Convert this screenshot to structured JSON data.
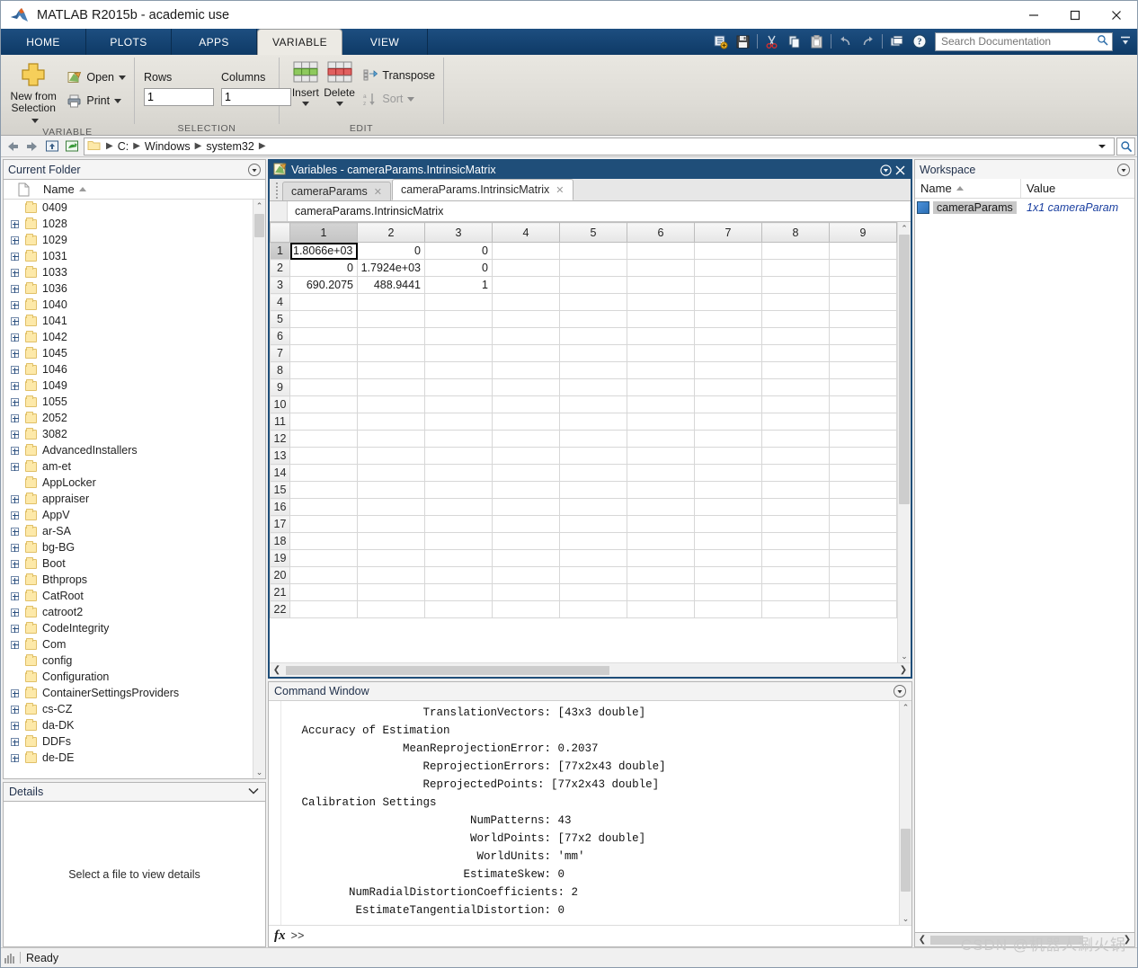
{
  "window": {
    "title": "MATLAB R2015b - academic use",
    "app_icon": "matlab-logo-icon",
    "minimize": "minimize-icon",
    "maximize": "maximize-icon",
    "close": "close-icon"
  },
  "ribbon": {
    "tabs": [
      {
        "label": "HOME",
        "active": false
      },
      {
        "label": "PLOTS",
        "active": false
      },
      {
        "label": "APPS",
        "active": false
      },
      {
        "label": "VARIABLE",
        "active": true
      },
      {
        "label": "VIEW",
        "active": false
      }
    ],
    "quick_access": [
      "new-script-icon",
      "save-icon",
      "cut-icon",
      "copy-icon",
      "paste-icon",
      "undo-icon",
      "redo-icon",
      "switch-windows-icon",
      "help-icon"
    ],
    "search": {
      "placeholder": "Search Documentation",
      "value": "",
      "icon": "search-icon"
    },
    "minimize_ribbon": "minimize-ribbon-icon",
    "groups": [
      {
        "name": "VARIABLE",
        "label": "VARIABLE",
        "new_from_selection": "New from\nSelection",
        "new_from_selection_line1": "New from",
        "new_from_selection_line2": "Selection",
        "open_label": "Open",
        "print_label": "Print"
      },
      {
        "name": "SELECTION",
        "label": "SELECTION",
        "rows_label": "Rows",
        "rows_value": "1",
        "columns_label": "Columns",
        "columns_value": "1"
      },
      {
        "name": "EDIT",
        "label": "EDIT",
        "insert_label": "Insert",
        "delete_label": "Delete",
        "transpose_label": "Transpose",
        "sort_label": "Sort"
      }
    ]
  },
  "addressbar": {
    "back_icon": "back-arrow-icon",
    "forward_icon": "forward-arrow-icon",
    "up_icon": "up-folder-icon",
    "browse_icon": "browse-folder-icon",
    "folder_icon": "folder-icon",
    "crumbs": [
      "C:",
      "Windows",
      "system32"
    ],
    "dropdown_icon": "chevron-down-icon",
    "search_icon": "search-icon"
  },
  "current_folder": {
    "title": "Current Folder",
    "panel_menu_icon": "panel-menu-icon",
    "columns": [
      "Name"
    ],
    "sort_icon": "sort-ascending-icon",
    "file_icon": "file-icon",
    "items": [
      {
        "name": "0409",
        "expandable": false
      },
      {
        "name": "1028",
        "expandable": true
      },
      {
        "name": "1029",
        "expandable": true
      },
      {
        "name": "1031",
        "expandable": true
      },
      {
        "name": "1033",
        "expandable": true
      },
      {
        "name": "1036",
        "expandable": true
      },
      {
        "name": "1040",
        "expandable": true
      },
      {
        "name": "1041",
        "expandable": true
      },
      {
        "name": "1042",
        "expandable": true
      },
      {
        "name": "1045",
        "expandable": true
      },
      {
        "name": "1046",
        "expandable": true
      },
      {
        "name": "1049",
        "expandable": true
      },
      {
        "name": "1055",
        "expandable": true
      },
      {
        "name": "2052",
        "expandable": true
      },
      {
        "name": "3082",
        "expandable": true
      },
      {
        "name": "AdvancedInstallers",
        "expandable": true
      },
      {
        "name": "am-et",
        "expandable": true
      },
      {
        "name": "AppLocker",
        "expandable": false
      },
      {
        "name": "appraiser",
        "expandable": true
      },
      {
        "name": "AppV",
        "expandable": true
      },
      {
        "name": "ar-SA",
        "expandable": true
      },
      {
        "name": "bg-BG",
        "expandable": true
      },
      {
        "name": "Boot",
        "expandable": true
      },
      {
        "name": "Bthprops",
        "expandable": true
      },
      {
        "name": "CatRoot",
        "expandable": true
      },
      {
        "name": "catroot2",
        "expandable": true
      },
      {
        "name": "CodeIntegrity",
        "expandable": true
      },
      {
        "name": "Com",
        "expandable": true
      },
      {
        "name": "config",
        "expandable": false
      },
      {
        "name": "Configuration",
        "expandable": false
      },
      {
        "name": "ContainerSettingsProviders",
        "expandable": true
      },
      {
        "name": "cs-CZ",
        "expandable": true
      },
      {
        "name": "da-DK",
        "expandable": true
      },
      {
        "name": "DDFs",
        "expandable": true
      },
      {
        "name": "de-DE",
        "expandable": true
      }
    ]
  },
  "details": {
    "title": "Details",
    "collapse_icon": "chevron-down-icon",
    "empty_message": "Select a file to view details"
  },
  "variables": {
    "window_title": "Variables - cameraParams.IntrinsicMatrix",
    "window_icon": "variable-editor-icon",
    "menu_icon": "panel-menu-icon",
    "close_icon": "close-icon",
    "tabs": [
      {
        "label": "cameraParams",
        "active": false,
        "close_icon": "close-tab-icon"
      },
      {
        "label": "cameraParams.IntrinsicMatrix",
        "active": true,
        "close_icon": "close-tab-icon"
      }
    ],
    "variable_name": "cameraParams.IntrinsicMatrix",
    "column_headers": [
      "1",
      "2",
      "3",
      "4",
      "5",
      "6",
      "7",
      "8",
      "9"
    ],
    "row_headers": [
      "1",
      "2",
      "3",
      "4",
      "5",
      "6",
      "7",
      "8",
      "9",
      "10",
      "11",
      "12",
      "13",
      "14",
      "15",
      "16",
      "17",
      "18",
      "19",
      "20",
      "21",
      "22"
    ],
    "selected_cell": {
      "row": 1,
      "col": 1
    },
    "data": [
      [
        "1.8066e+03",
        "0",
        "0",
        "",
        "",
        "",
        "",
        "",
        ""
      ],
      [
        "0",
        "1.7924e+03",
        "0",
        "",
        "",
        "",
        "",
        "",
        ""
      ],
      [
        "690.2075",
        "488.9441",
        "1",
        "",
        "",
        "",
        "",
        "",
        ""
      ]
    ],
    "hscroll_left_icon": "scroll-left-icon",
    "hscroll_right_icon": "scroll-right-icon"
  },
  "command_window": {
    "title": "Command Window",
    "menu_icon": "panel-menu-icon",
    "prompt_icon": "fx-icon",
    "prompt": ">>",
    "lines": [
      "                     TranslationVectors: [43x3 double]",
      "   Accuracy of Estimation",
      "                  MeanReprojectionError: 0.2037",
      "                     ReprojectionErrors: [77x2x43 double]",
      "                     ReprojectedPoints: [77x2x43 double]",
      "   Calibration Settings",
      "                            NumPatterns: 43",
      "                            WorldPoints: [77x2 double]",
      "                             WorldUnits: 'mm'",
      "                           EstimateSkew: 0",
      "          NumRadialDistortionCoefficients: 2",
      "           EstimateTangentialDistortion: 0"
    ]
  },
  "workspace": {
    "title": "Workspace",
    "menu_icon": "panel-menu-icon",
    "columns": [
      "Name",
      "Value"
    ],
    "sort_icon": "sort-ascending-icon",
    "rows": [
      {
        "icon": "object-variable-icon",
        "name": "cameraParams",
        "value": "1x1 cameraParam"
      }
    ]
  },
  "statusbar": {
    "busy_icon": "busy-indicator-icon",
    "text": "Ready"
  },
  "watermark": "CSDN @机器人涮火锅",
  "colors": {
    "ribbon_blue": "#0e3a66",
    "panel_title_blue": "#1f4e79",
    "accent_orange": "#e8a33d"
  }
}
